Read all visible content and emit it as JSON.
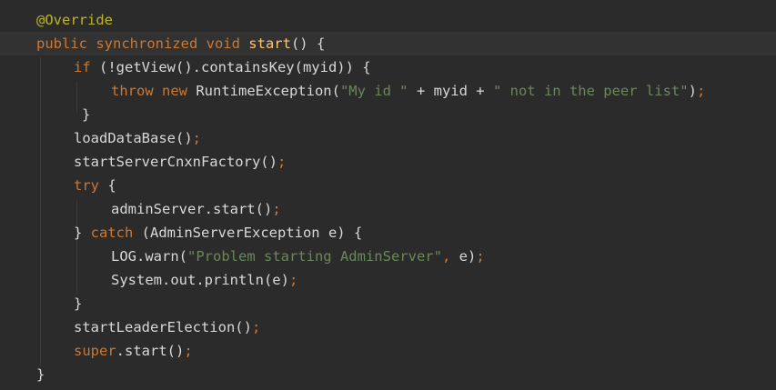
{
  "editor": {
    "language": "Java",
    "colors": {
      "background": "#2b2b2b",
      "keyword": "#cc7832",
      "annotation": "#bbb529",
      "string": "#6a8759",
      "method_declaration": "#ffc66d",
      "text": "#d8d8d8"
    },
    "lines": [
      {
        "indent": 0,
        "tokens": [
          {
            "t": "@Override",
            "k": "annotation"
          }
        ]
      },
      {
        "indent": 0,
        "highlighted": true,
        "tokens": [
          {
            "t": "public synchronized void ",
            "k": "keyword"
          },
          {
            "t": "start",
            "k": "method-decl"
          },
          {
            "t": "() {",
            "k": "plain"
          }
        ]
      },
      {
        "indent": 1,
        "tokens": [
          {
            "t": "if",
            "k": "keyword"
          },
          {
            "t": " (!getView().containsKey(myid)) {",
            "k": "plain"
          }
        ]
      },
      {
        "indent": 2,
        "tokens": [
          {
            "t": "throw new ",
            "k": "keyword"
          },
          {
            "t": "RuntimeException(",
            "k": "plain"
          },
          {
            "t": "\"My id \"",
            "k": "string"
          },
          {
            "t": " + myid + ",
            "k": "plain"
          },
          {
            "t": "\" not in the peer list\"",
            "k": "string"
          },
          {
            "t": ")",
            "k": "plain"
          },
          {
            "t": ";",
            "k": "punct"
          }
        ]
      },
      {
        "indent": 1,
        "extra": 1,
        "tokens": [
          {
            "t": "}",
            "k": "plain"
          }
        ]
      },
      {
        "indent": 1,
        "tokens": [
          {
            "t": "loadDataBase()",
            "k": "plain"
          },
          {
            "t": ";",
            "k": "punct"
          }
        ]
      },
      {
        "indent": 1,
        "tokens": [
          {
            "t": "startServerCnxnFactory()",
            "k": "plain"
          },
          {
            "t": ";",
            "k": "punct"
          }
        ]
      },
      {
        "indent": 1,
        "tokens": [
          {
            "t": "try",
            "k": "keyword"
          },
          {
            "t": " {",
            "k": "plain"
          }
        ]
      },
      {
        "indent": 2,
        "tokens": [
          {
            "t": "adminServer.start()",
            "k": "plain"
          },
          {
            "t": ";",
            "k": "punct"
          }
        ]
      },
      {
        "indent": 1,
        "tokens": [
          {
            "t": "} ",
            "k": "plain"
          },
          {
            "t": "catch",
            "k": "keyword"
          },
          {
            "t": " (AdminServerException e) {",
            "k": "plain"
          }
        ]
      },
      {
        "indent": 2,
        "tokens": [
          {
            "t": "LOG.warn(",
            "k": "plain"
          },
          {
            "t": "\"Problem starting AdminServer\"",
            "k": "string"
          },
          {
            "t": ", ",
            "k": "punct"
          },
          {
            "t": "e)",
            "k": "plain"
          },
          {
            "t": ";",
            "k": "punct"
          }
        ]
      },
      {
        "indent": 2,
        "tokens": [
          {
            "t": "System.out.println(e)",
            "k": "plain"
          },
          {
            "t": ";",
            "k": "punct"
          }
        ]
      },
      {
        "indent": 1,
        "tokens": [
          {
            "t": "}",
            "k": "plain"
          }
        ]
      },
      {
        "indent": 1,
        "tokens": [
          {
            "t": "startLeaderElection()",
            "k": "plain"
          },
          {
            "t": ";",
            "k": "punct"
          }
        ]
      },
      {
        "indent": 1,
        "tokens": [
          {
            "t": "super",
            "k": "keyword"
          },
          {
            "t": ".start()",
            "k": "plain"
          },
          {
            "t": ";",
            "k": "punct"
          }
        ]
      },
      {
        "indent": 0,
        "tokens": [
          {
            "t": "}",
            "k": "plain"
          }
        ]
      }
    ]
  }
}
